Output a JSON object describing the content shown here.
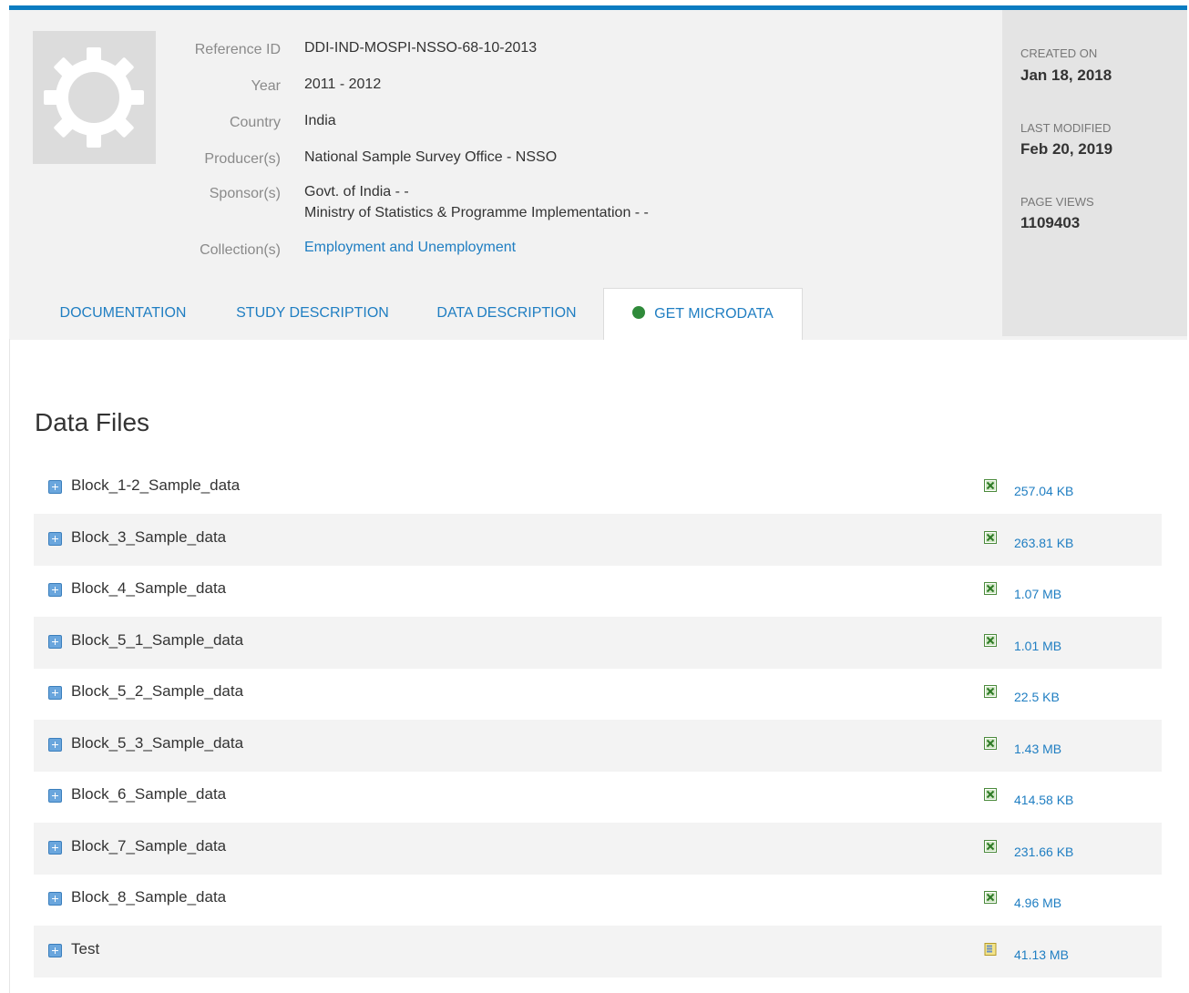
{
  "metadata": {
    "reference_id_label": "Reference ID",
    "reference_id": "DDI-IND-MOSPI-NSSO-68-10-2013",
    "year_label": "Year",
    "year": "2011 - 2012",
    "country_label": "Country",
    "country": "India",
    "producers_label": "Producer(s)",
    "producers": "National Sample Survey Office - NSSO",
    "sponsors_label": "Sponsor(s)",
    "sponsor_1": "Govt. of India - -",
    "sponsor_2": "Ministry of Statistics & Programme Implementation - -",
    "collections_label": "Collection(s)",
    "collection": "Employment and Unemployment"
  },
  "side": {
    "created_label": "CREATED ON",
    "created": "Jan 18, 2018",
    "modified_label": "LAST MODIFIED",
    "modified": "Feb 20, 2019",
    "views_label": "PAGE VIEWS",
    "views": "1109403"
  },
  "tabs": [
    {
      "label": "DOCUMENTATION"
    },
    {
      "label": "STUDY DESCRIPTION"
    },
    {
      "label": "DATA DESCRIPTION"
    },
    {
      "label": "GET MICRODATA"
    }
  ],
  "section_title": "Data Files",
  "files": [
    {
      "name": "Block_1-2_Sample_data",
      "size": "257.04 KB",
      "icon": "excel-icon"
    },
    {
      "name": "Block_3_Sample_data",
      "size": "263.81 KB",
      "icon": "excel-icon"
    },
    {
      "name": "Block_4_Sample_data",
      "size": "1.07 MB",
      "icon": "excel-icon"
    },
    {
      "name": "Block_5_1_Sample_data",
      "size": "1.01 MB",
      "icon": "excel-icon"
    },
    {
      "name": "Block_5_2_Sample_data",
      "size": "22.5 KB",
      "icon": "excel-icon"
    },
    {
      "name": "Block_5_3_Sample_data",
      "size": "1.43 MB",
      "icon": "excel-icon"
    },
    {
      "name": "Block_6_Sample_data",
      "size": "414.58 KB",
      "icon": "excel-icon"
    },
    {
      "name": "Block_7_Sample_data",
      "size": "231.66 KB",
      "icon": "excel-icon"
    },
    {
      "name": "Block_8_Sample_data",
      "size": "4.96 MB",
      "icon": "excel-icon"
    },
    {
      "name": "Test",
      "size": "41.13 MB",
      "icon": "archive-icon"
    }
  ]
}
